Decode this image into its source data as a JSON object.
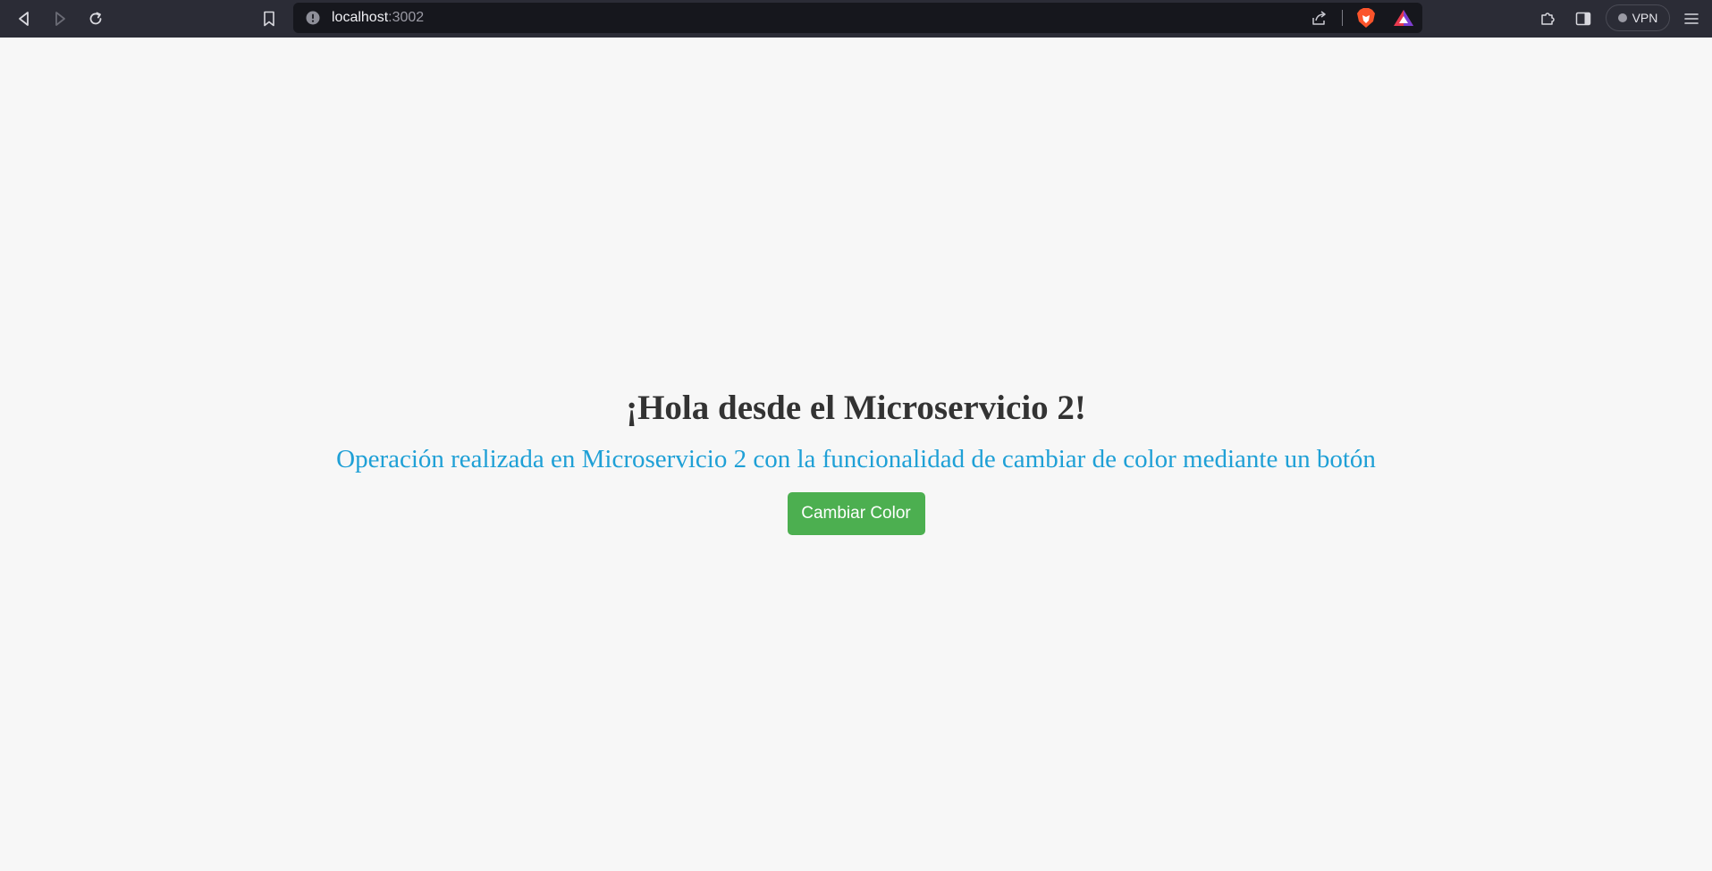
{
  "browser": {
    "address": {
      "host": "localhost",
      "port": ":3002"
    },
    "vpn_label": "VPN",
    "icons": {
      "back": "back-arrow-icon",
      "forward": "forward-arrow-icon",
      "reload": "reload-icon",
      "bookmark": "bookmark-icon",
      "site_info": "site-info-icon",
      "share": "share-icon",
      "brave_shield": "brave-shield-icon",
      "rewards": "brave-rewards-icon",
      "extensions": "extensions-icon",
      "sidebar": "sidebar-toggle-icon",
      "menu": "hamburger-menu-icon"
    }
  },
  "page": {
    "heading": "¡Hola desde el Microservicio 2!",
    "subtitle": "Operación realizada en Microservicio 2 con la funcionalidad de cambiar de color mediante un botón",
    "button_label": "Cambiar Color"
  },
  "colors": {
    "page_background": "#f7f7f7",
    "heading": "#333333",
    "subtitle": "#1fa0d6",
    "button_background": "#4caf50",
    "button_text": "#ffffff",
    "toolbar": "#2b2c36",
    "address_bar": "#16171d"
  }
}
